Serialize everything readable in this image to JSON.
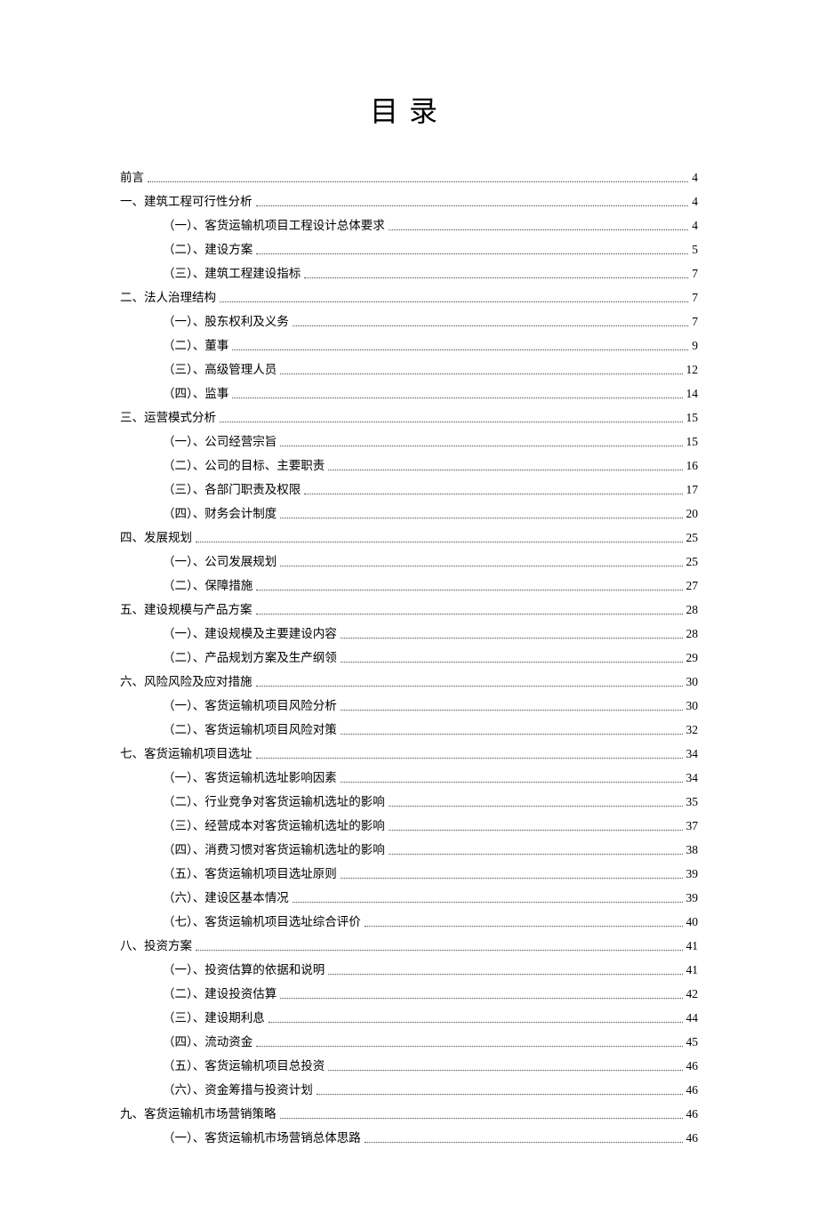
{
  "title": "目录",
  "entries": [
    {
      "level": 0,
      "label": "前言",
      "page": "4"
    },
    {
      "level": 0,
      "label": "一、建筑工程可行性分析",
      "page": "4"
    },
    {
      "level": 1,
      "label": "（一）、客货运输机项目工程设计总体要求",
      "page": "4"
    },
    {
      "level": 1,
      "label": "（二）、建设方案",
      "page": "5"
    },
    {
      "level": 1,
      "label": "（三）、建筑工程建设指标",
      "page": "7"
    },
    {
      "level": 0,
      "label": "二、法人治理结构",
      "page": "7"
    },
    {
      "level": 1,
      "label": "（一）、股东权利及义务",
      "page": "7"
    },
    {
      "level": 1,
      "label": "（二）、董事",
      "page": "9"
    },
    {
      "level": 1,
      "label": "（三）、高级管理人员",
      "page": "12"
    },
    {
      "level": 1,
      "label": "（四）、监事",
      "page": "14"
    },
    {
      "level": 0,
      "label": "三、运营模式分析",
      "page": "15"
    },
    {
      "level": 1,
      "label": "（一）、公司经营宗旨",
      "page": "15"
    },
    {
      "level": 1,
      "label": "（二）、公司的目标、主要职责",
      "page": "16"
    },
    {
      "level": 1,
      "label": "（三）、各部门职责及权限",
      "page": "17"
    },
    {
      "level": 1,
      "label": "（四）、财务会计制度",
      "page": "20"
    },
    {
      "level": 0,
      "label": "四、发展规划",
      "page": "25"
    },
    {
      "level": 1,
      "label": "（一）、公司发展规划",
      "page": "25"
    },
    {
      "level": 1,
      "label": "（二）、保障措施",
      "page": "27"
    },
    {
      "level": 0,
      "label": "五、建设规模与产品方案",
      "page": "28"
    },
    {
      "level": 1,
      "label": "（一）、建设规模及主要建设内容",
      "page": "28"
    },
    {
      "level": 1,
      "label": "（二）、产品规划方案及生产纲领",
      "page": "29"
    },
    {
      "level": 0,
      "label": "六、风险风险及应对措施",
      "page": "30"
    },
    {
      "level": 1,
      "label": "（一）、客货运输机项目风险分析",
      "page": "30"
    },
    {
      "level": 1,
      "label": "（二）、客货运输机项目风险对策",
      "page": "32"
    },
    {
      "level": 0,
      "label": "七、客货运输机项目选址",
      "page": "34"
    },
    {
      "level": 1,
      "label": "（一）、客货运输机选址影响因素",
      "page": "34"
    },
    {
      "level": 1,
      "label": "（二）、行业竞争对客货运输机选址的影响",
      "page": "35"
    },
    {
      "level": 1,
      "label": "（三）、经营成本对客货运输机选址的影响",
      "page": "37"
    },
    {
      "level": 1,
      "label": "（四）、消费习惯对客货运输机选址的影响",
      "page": "38"
    },
    {
      "level": 1,
      "label": "（五）、客货运输机项目选址原则",
      "page": "39"
    },
    {
      "level": 1,
      "label": "（六）、建设区基本情况",
      "page": "39"
    },
    {
      "level": 1,
      "label": "（七）、客货运输机项目选址综合评价",
      "page": "40"
    },
    {
      "level": 0,
      "label": "八、投资方案",
      "page": "41"
    },
    {
      "level": 1,
      "label": "（一）、投资估算的依据和说明",
      "page": "41"
    },
    {
      "level": 1,
      "label": "（二）、建设投资估算",
      "page": "42"
    },
    {
      "level": 1,
      "label": "（三）、建设期利息",
      "page": "44"
    },
    {
      "level": 1,
      "label": "（四）、流动资金",
      "page": "45"
    },
    {
      "level": 1,
      "label": "（五）、客货运输机项目总投资",
      "page": "46"
    },
    {
      "level": 1,
      "label": "（六）、资金筹措与投资计划",
      "page": "46"
    },
    {
      "level": 0,
      "label": "九、客货运输机市场营销策略",
      "page": "46"
    },
    {
      "level": 1,
      "label": "（一）、客货运输机市场营销总体思路",
      "page": "46"
    }
  ]
}
